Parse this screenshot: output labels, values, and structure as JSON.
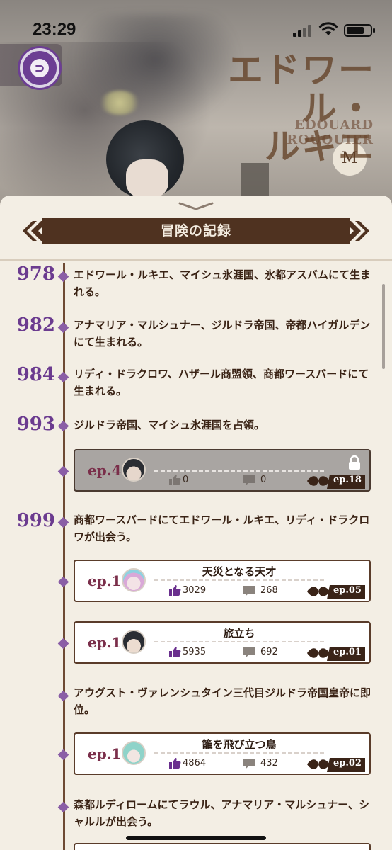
{
  "status_bar": {
    "time": "23:29"
  },
  "character": {
    "name_jp_line1": "エドワール・",
    "name_jp_line2": "ルキエ",
    "name_en": "EDOUARD ROUQUIER",
    "badge": "M"
  },
  "panel": {
    "title": "冒険の記録"
  },
  "timeline": [
    {
      "year": "978",
      "text": "エドワール・ルキエ、マイシュ氷涯国、氷都アスバムにて生まれる。"
    },
    {
      "year": "982",
      "text": "アナマリア・マルシュナー、ジルドラ帝国、帝都ハイガルデンにて生まれる。"
    },
    {
      "year": "984",
      "text": "リディ・ドラクロワ、ハザール商盟領、商都ワースバードにて生まれる。"
    },
    {
      "year": "993",
      "text": "ジルドラ帝国、マイシュ氷涯国を占領。"
    },
    {
      "year": "999",
      "text": "商都ワースバードにてエドワール・ルキエ、リディ・ドラクロワが出会う。"
    },
    {
      "year": "",
      "text": "アウグスト・ヴァレンシュタイン三代目ジルドラ帝国皇帝に即位。"
    },
    {
      "year": "",
      "text": "森都ルディロームにてラウル、アナマリア・マルシュナー、シャルルが出会う。"
    }
  ],
  "cards": [
    {
      "ep": "ep.4",
      "title": "",
      "likes": "0",
      "comments": "0",
      "tag": "ep.18",
      "locked": true
    },
    {
      "ep": "ep.1",
      "title": "天災となる天才",
      "likes": "3029",
      "comments": "268",
      "tag": "ep.05",
      "locked": false
    },
    {
      "ep": "ep.1",
      "title": "旅立ち",
      "likes": "5935",
      "comments": "692",
      "tag": "ep.01",
      "locked": false
    },
    {
      "ep": "ep.1",
      "title": "籠を飛び立つ鳥",
      "likes": "4864",
      "comments": "432",
      "tag": "ep.02",
      "locked": false
    }
  ],
  "icons": [
    "back-icon",
    "signal-icon",
    "wifi-icon",
    "battery-icon",
    "chevron-down-icon",
    "lock-icon",
    "like-icon",
    "comment-icon"
  ]
}
